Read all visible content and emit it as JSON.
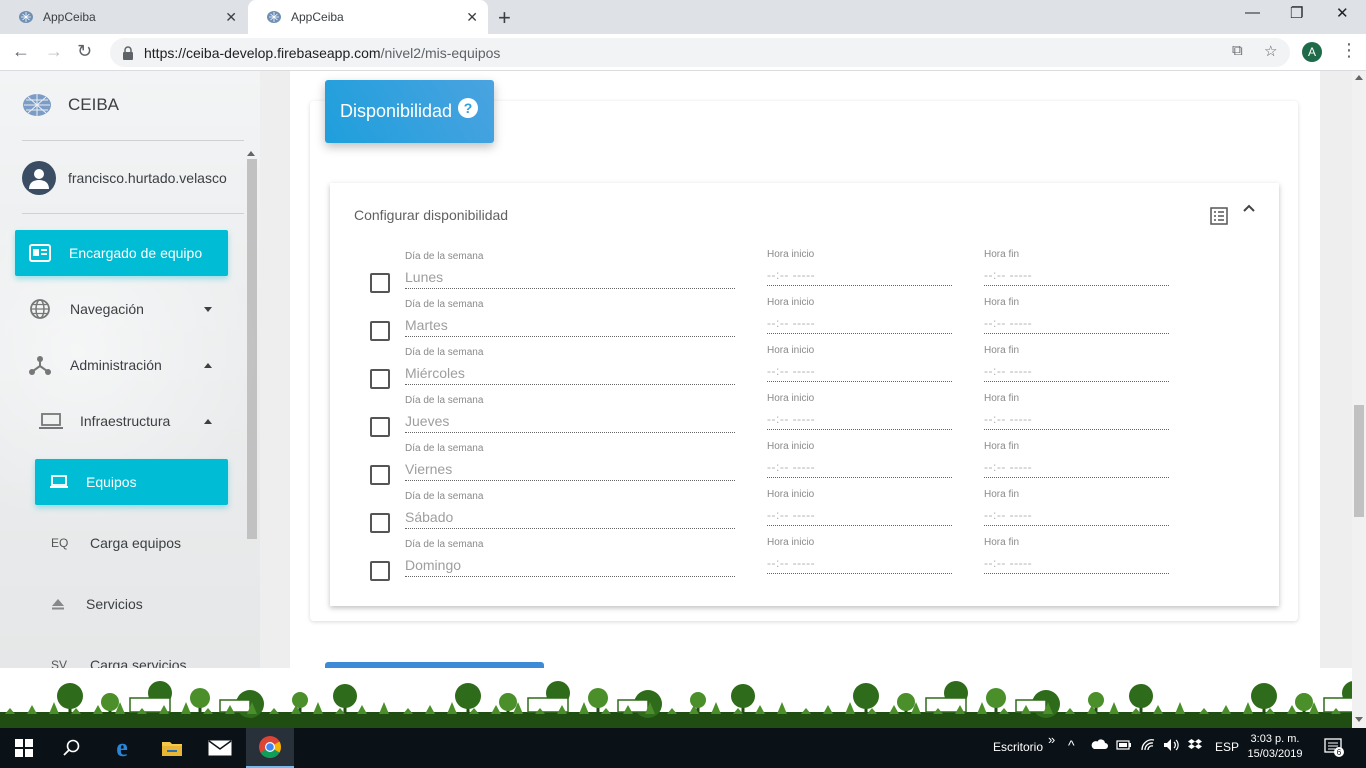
{
  "browser": {
    "tabs": [
      {
        "title": "AppCeiba",
        "active": false
      },
      {
        "title": "AppCeiba",
        "active": true
      }
    ],
    "url_host": "https://ceiba-develop.firebaseapp.com",
    "url_path": "/nivel2/mis-equipos",
    "profile_initial": "A"
  },
  "sidebar": {
    "brand": "CEIBA",
    "user": "francisco.hurtado.velasco",
    "items": [
      {
        "label": "Encargado de equipo",
        "icon": "dashboard-icon",
        "active": true
      },
      {
        "label": "Navegación",
        "icon": "globe-icon",
        "caret": "down"
      },
      {
        "label": "Administración",
        "icon": "hierarchy-icon",
        "caret": "up"
      },
      {
        "label": "Infraestructura",
        "icon": "laptop-icon",
        "caret": "up"
      },
      {
        "label": "Equipos",
        "icon": "laptop-icon",
        "active": true
      },
      {
        "label": "Carga equipos",
        "abbr": "EQ"
      },
      {
        "label": "Servicios",
        "icon": "eject-icon"
      },
      {
        "label": "Carga servicios",
        "abbr": "SV"
      }
    ]
  },
  "main": {
    "header_title": "Disponibilidad",
    "panel": {
      "title": "Configurar disponibilidad",
      "field_label_day": "Día de la semana",
      "field_label_start": "Hora inicio",
      "field_label_end": "Hora fin",
      "time_placeholder": "--:-- -----",
      "days": [
        "Lunes",
        "Martes",
        "Miércoles",
        "Jueves",
        "Viernes",
        "Sábado",
        "Domingo"
      ]
    }
  },
  "taskbar": {
    "desktop_label": "Escritorio",
    "language": "ESP",
    "time": "3:03 p. m.",
    "date": "15/03/2019",
    "notifications": "6"
  },
  "colors": {
    "accent_cyan": "#00bcd4",
    "header_blue": "#2196f3",
    "forest_green": "#2e6b1a"
  }
}
